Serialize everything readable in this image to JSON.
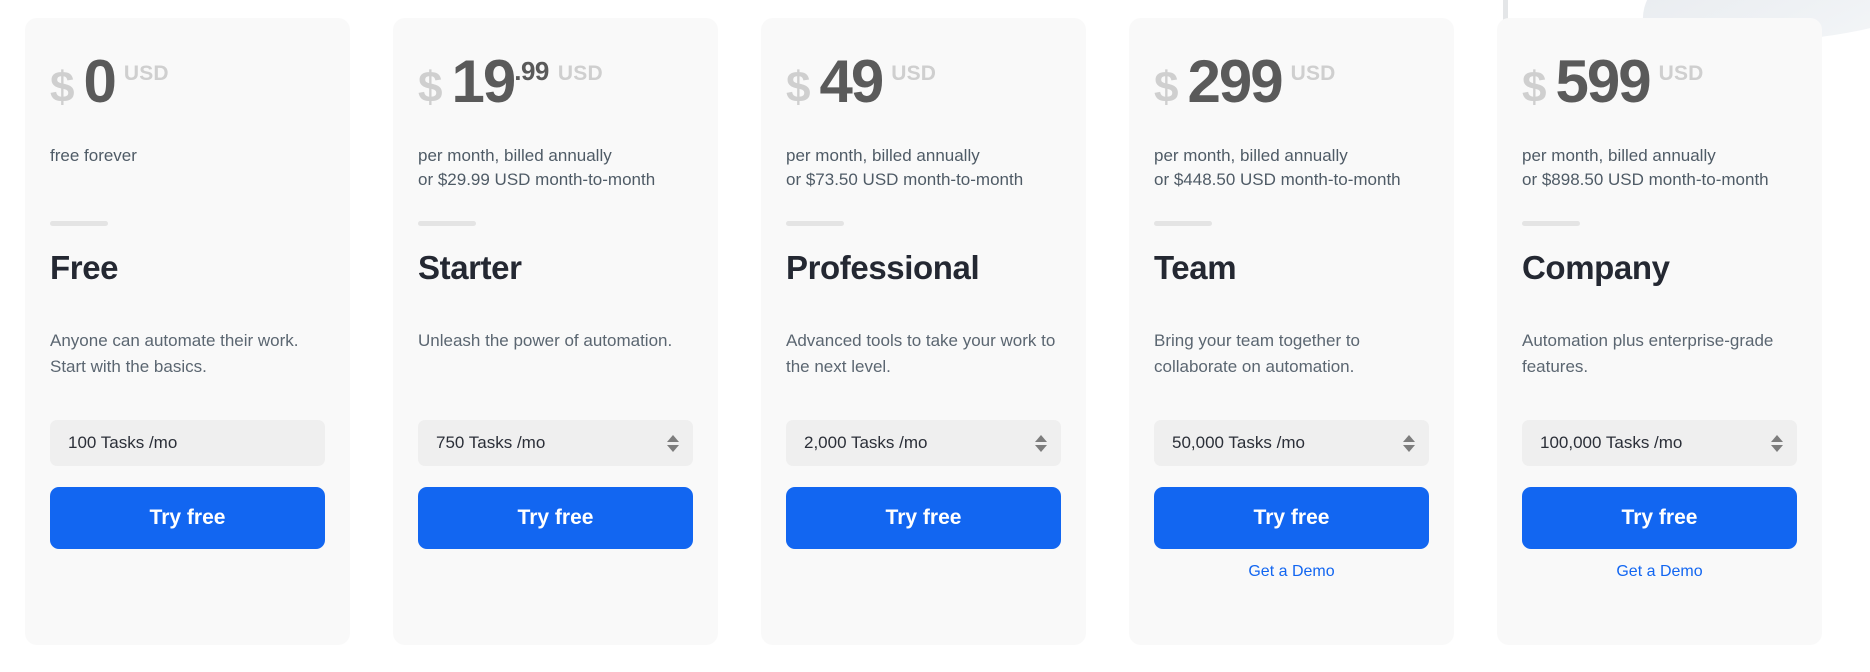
{
  "plans": [
    {
      "currency_symbol": "$",
      "amount": "0",
      "cents": "",
      "currency_code": "USD",
      "billing_line_1": "free forever",
      "billing_line_2": "",
      "name": "Free",
      "description": "Anyone can automate their work. Start with the basics.",
      "tasks_value": "100 Tasks /mo",
      "has_stepper": false,
      "cta_label": "Try free",
      "demo_label": "",
      "has_demo": false
    },
    {
      "currency_symbol": "$",
      "amount": "19",
      "cents": ".99",
      "currency_code": "USD",
      "billing_line_1": "per month, billed annually",
      "billing_line_2": "or $29.99 USD month-to-month",
      "name": "Starter",
      "description": "Unleash the power of automation.",
      "tasks_value": "750 Tasks /mo",
      "has_stepper": true,
      "cta_label": "Try free",
      "demo_label": "",
      "has_demo": false
    },
    {
      "currency_symbol": "$",
      "amount": "49",
      "cents": "",
      "currency_code": "USD",
      "billing_line_1": "per month, billed annually",
      "billing_line_2": "or $73.50 USD month-to-month",
      "name": "Professional",
      "description": "Advanced tools to take your work to the next level.",
      "tasks_value": "2,000 Tasks /mo",
      "has_stepper": true,
      "cta_label": "Try free",
      "demo_label": "",
      "has_demo": false
    },
    {
      "currency_symbol": "$",
      "amount": "299",
      "cents": "",
      "currency_code": "USD",
      "billing_line_1": "per month, billed annually",
      "billing_line_2": "or $448.50 USD month-to-month",
      "name": "Team",
      "description": "Bring your team together to collaborate on automation.",
      "tasks_value": "50,000 Tasks /mo",
      "has_stepper": true,
      "cta_label": "Try free",
      "demo_label": "Get a Demo",
      "has_demo": true
    },
    {
      "currency_symbol": "$",
      "amount": "599",
      "cents": "",
      "currency_code": "USD",
      "billing_line_1": "per month, billed annually",
      "billing_line_2": "or $898.50 USD month-to-month",
      "name": "Company",
      "description": "Automation plus enterprise-grade features.",
      "tasks_value": "100,000 Tasks /mo",
      "has_stepper": true,
      "cta_label": "Try free",
      "demo_label": "Get a Demo",
      "has_demo": true
    }
  ],
  "colors": {
    "accent": "#1266f1",
    "card_background": "#f9f9f9",
    "select_background": "#efefef",
    "price_number": "#5a5a5a",
    "price_muted": "#cfcfcf",
    "plan_name": "#242832",
    "body_text": "#5b6671",
    "divider": "#e4e4e4"
  }
}
